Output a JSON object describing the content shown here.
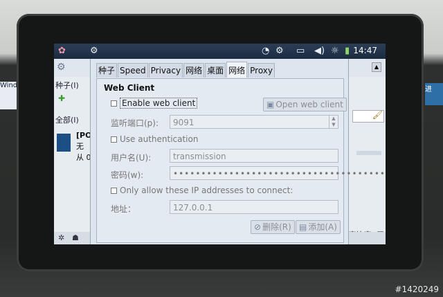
{
  "status_bar": {
    "time": "14:47",
    "icons": [
      "app-grid-icon",
      "transmission-icon",
      "wifi-icon",
      "transmission-icon",
      "battery-charge-icon",
      "volume-icon",
      "brightness-icon",
      "battery-icon"
    ]
  },
  "background_app": {
    "menu_label": "种子(I)",
    "filter_label": "全部(I)",
    "torrent_name": "[PO",
    "torrent_status": "无",
    "torrent_from": "从 0",
    "ratio_label": "享比率: 无",
    "left_strip_text": "Wind",
    "right_strip_text": "进"
  },
  "dialog": {
    "tabs": [
      {
        "label": "种子",
        "active": false
      },
      {
        "label": "Speed",
        "active": false
      },
      {
        "label": "Privacy",
        "active": false
      },
      {
        "label": "网络",
        "active": false
      },
      {
        "label": "桌面",
        "active": false
      },
      {
        "label": "网络",
        "active": true
      },
      {
        "label": "Proxy",
        "active": false
      }
    ],
    "section_title": "Web Client",
    "enable_label": "Enable web client",
    "open_button": "Open web client",
    "port_label": "监听端口(p):",
    "port_value": "9091",
    "use_auth_label": "Use authentication",
    "username_label": "用户名(U):",
    "username_value": "transmission",
    "password_label": "密码(w):",
    "password_dots": "••••••••••••••••••••••••••••••••••••••••",
    "ip_only_label": "Only allow these IP addresses to connect:",
    "address_label": "地址：",
    "address_value": "127.0.0.1",
    "delete_button": "删除(R)",
    "add_button": "添加(A)"
  },
  "watermark": "#1420249",
  "colors": {
    "statusbar": "#1f324b",
    "dialog_bg": "#dde5ee",
    "disabled_text": "#8a8f95"
  }
}
